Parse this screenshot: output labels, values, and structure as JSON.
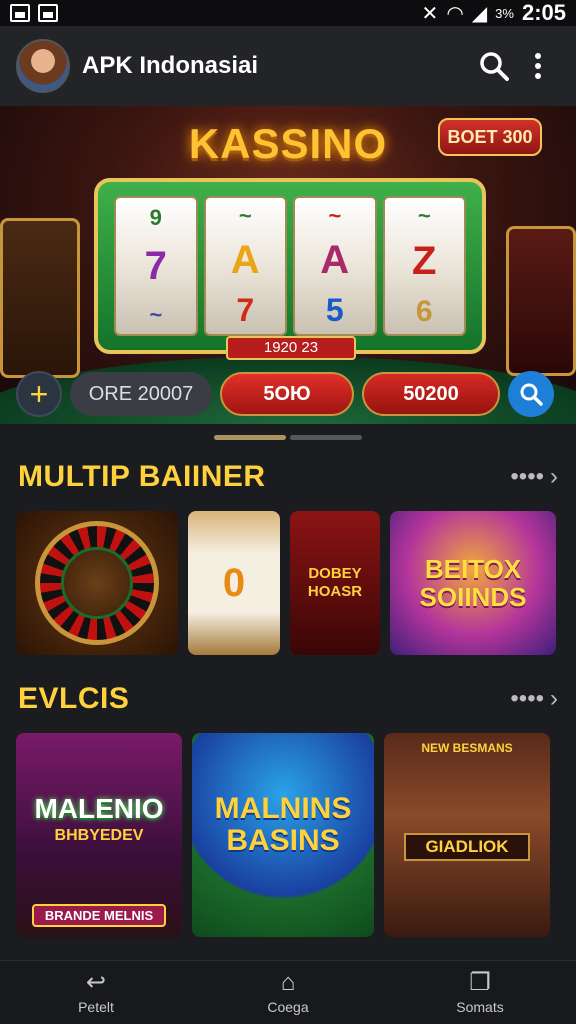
{
  "status": {
    "time": "2:05",
    "battery": "3%"
  },
  "app": {
    "title": "APK Indonasiai"
  },
  "banner": {
    "headline": "KASSINO",
    "bet_badge": "BOET 300",
    "reels": [
      {
        "top": "9",
        "mid": "7",
        "bot": "~"
      },
      {
        "top": "~",
        "mid": "A",
        "bot": "7"
      },
      {
        "top": "~",
        "mid": "A",
        "bot": "5"
      },
      {
        "top": "~",
        "mid": "Z",
        "bot": "6"
      }
    ],
    "counter": "1920 23",
    "control_code": "ORE 20007",
    "btn_left": "5ОЮ",
    "btn_right": "50200"
  },
  "section1": {
    "title": "MULTIP BAIINER",
    "more": "••••"
  },
  "section1_cards": {
    "slot_symbol": "0",
    "dealer_text": "DOBEY HOASR",
    "bonus_line1": "BEITOX",
    "bonus_line2": "SOIINDS"
  },
  "section2": {
    "title": "EVLCIS",
    "more": "••••"
  },
  "section2_cards": {
    "card1_title": "MALENIO",
    "card1_sub": "BHBYEDEV",
    "card1_tag": "BRANDE MELNIS",
    "card2_title": "MALNINS BASINS",
    "card3_small": "NEW BESMANS",
    "card3_title": "GIADLIOK"
  },
  "nav": {
    "back_label": "Petelt",
    "home_label": "Coega",
    "recent_label": "Somats"
  },
  "colors": {
    "accent": "#ffd23d",
    "primary_blue": "#1e7fd8",
    "red": "#c8201a"
  },
  "icons": {
    "search": "search-icon",
    "more": "kebab-menu-icon",
    "plus": "plus-icon",
    "back": "back-icon",
    "home": "home-icon",
    "recent": "recent-apps-icon"
  }
}
